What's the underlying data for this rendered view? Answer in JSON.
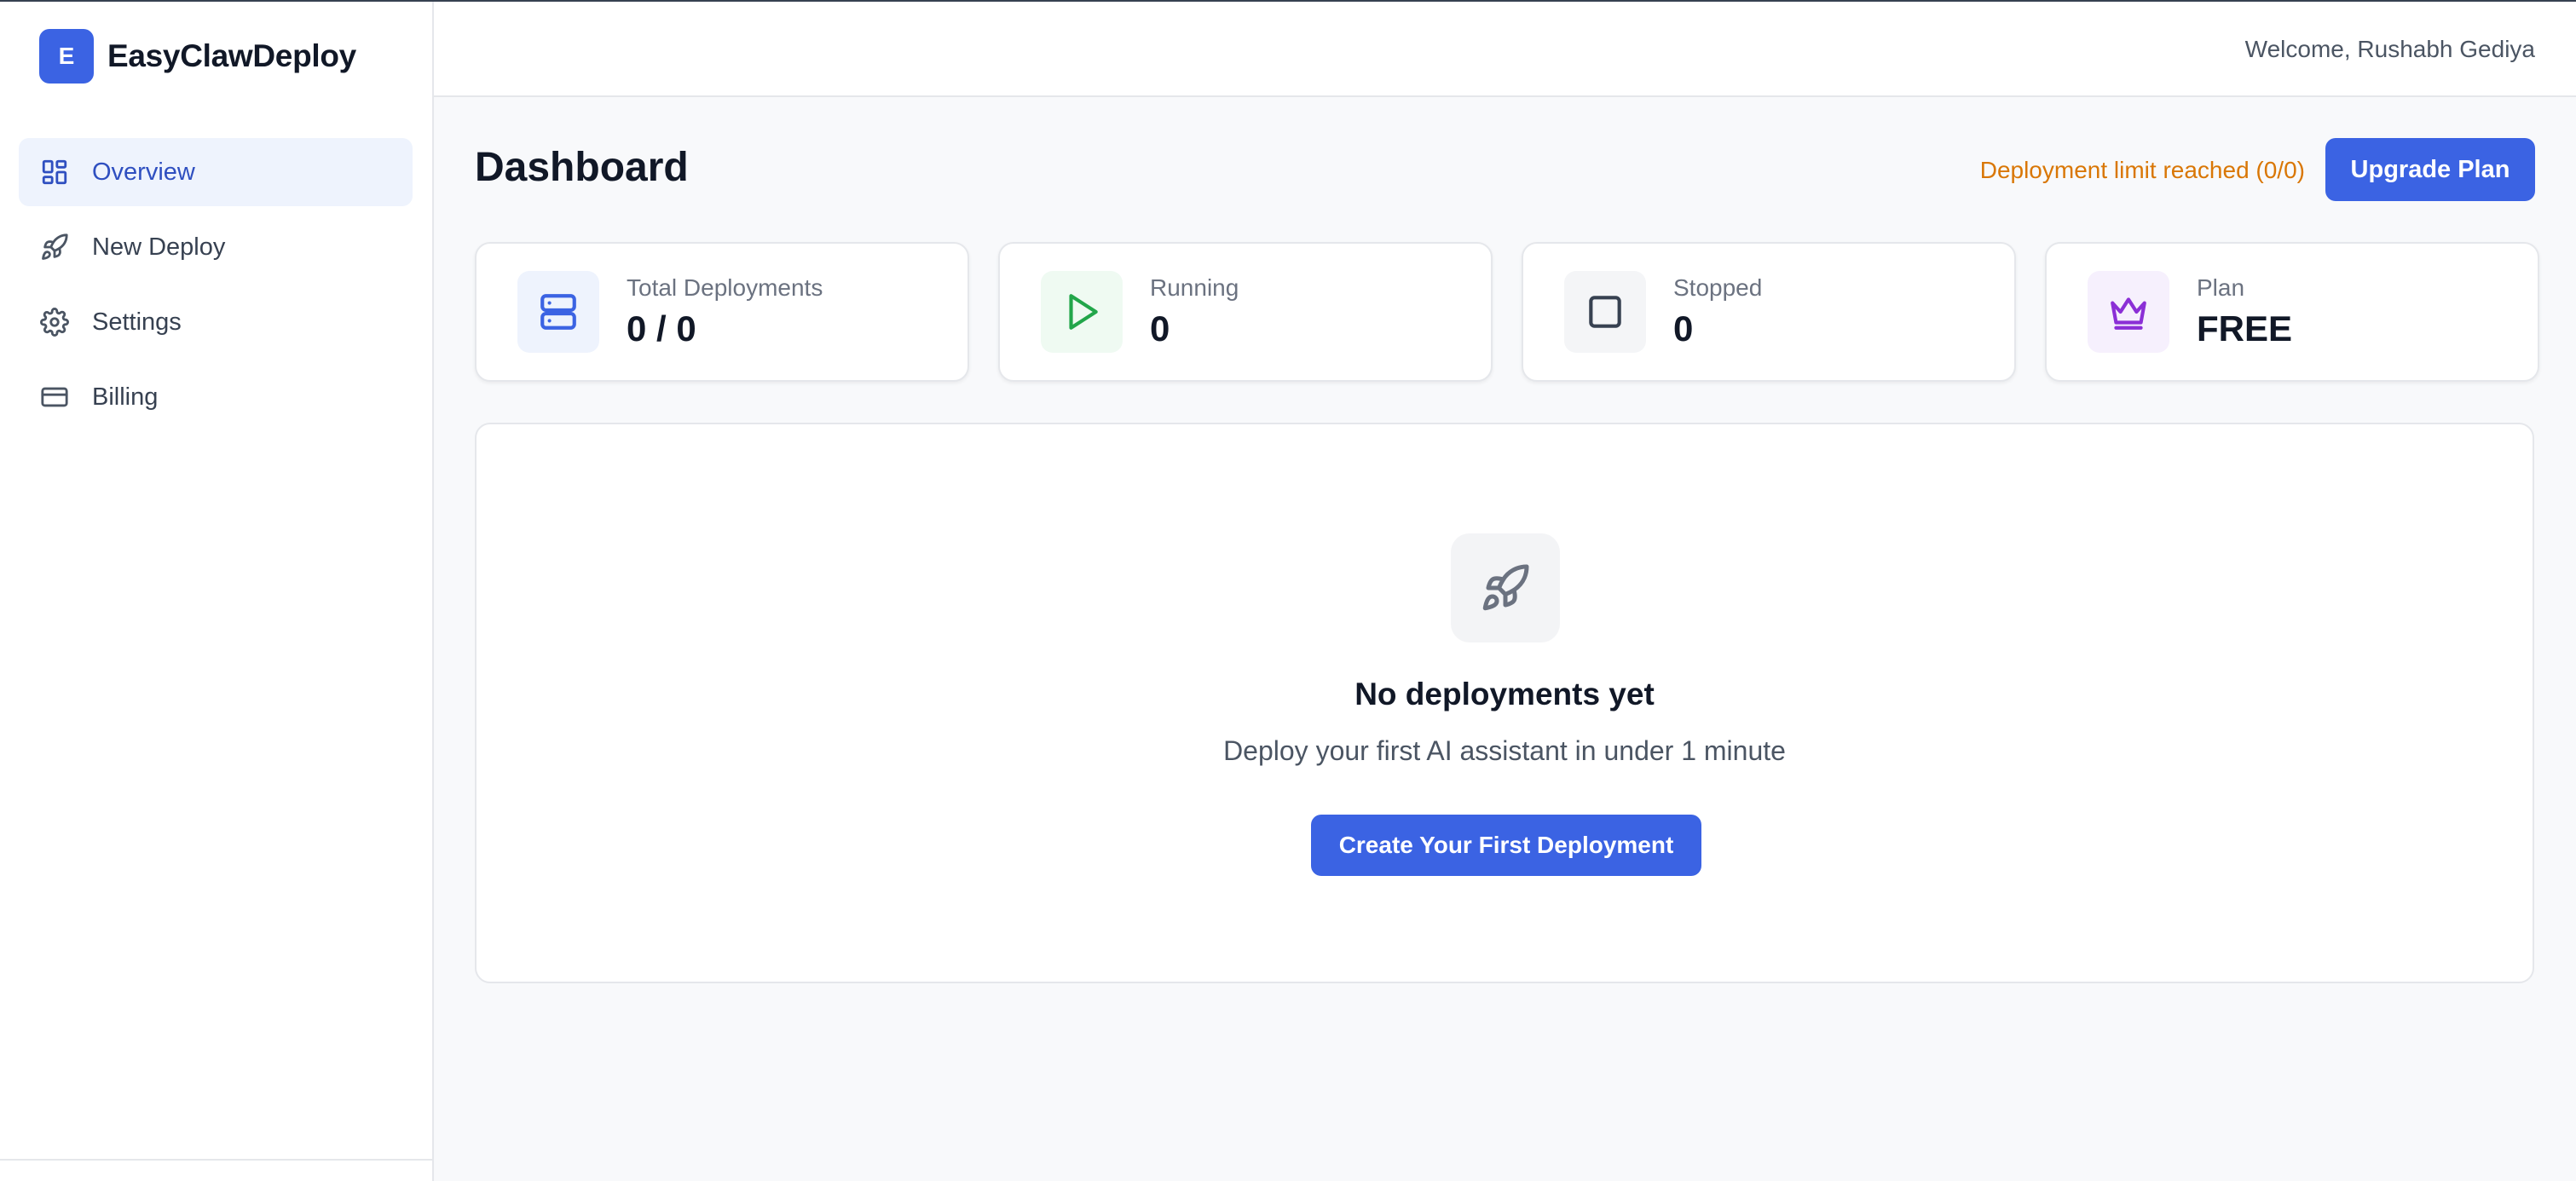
{
  "brand": {
    "logo_letter": "E",
    "name": "EasyClawDeploy"
  },
  "sidebar": {
    "items": [
      {
        "label": "Overview",
        "icon": "dashboard-grid-icon",
        "active": true
      },
      {
        "label": "New Deploy",
        "icon": "rocket-icon",
        "active": false
      },
      {
        "label": "Settings",
        "icon": "gear-icon",
        "active": false
      },
      {
        "label": "Billing",
        "icon": "credit-card-icon",
        "active": false
      }
    ]
  },
  "header": {
    "welcome": "Welcome, Rushabh Gediya"
  },
  "main": {
    "title": "Dashboard",
    "limit_notice": "Deployment limit reached (0/0)",
    "upgrade_label": "Upgrade Plan",
    "stats": [
      {
        "label": "Total Deployments",
        "value": "0 / 0",
        "icon": "server-icon",
        "color": "#3b63e3"
      },
      {
        "label": "Running",
        "value": "0",
        "icon": "play-icon",
        "color": "#22a64a"
      },
      {
        "label": "Stopped",
        "value": "0",
        "icon": "stop-square-icon",
        "color": "#374151"
      },
      {
        "label": "Plan",
        "value": "FREE",
        "icon": "crown-icon",
        "color": "#8b2fd6"
      }
    ],
    "empty_state": {
      "icon": "rocket-icon",
      "title": "No deployments yet",
      "subtitle": "Deploy your first AI assistant in under 1 minute",
      "cta_label": "Create Your First Deployment"
    }
  },
  "colors": {
    "accent": "#3b63e3",
    "warning": "#d97706",
    "active_bg": "#eef3fd"
  }
}
